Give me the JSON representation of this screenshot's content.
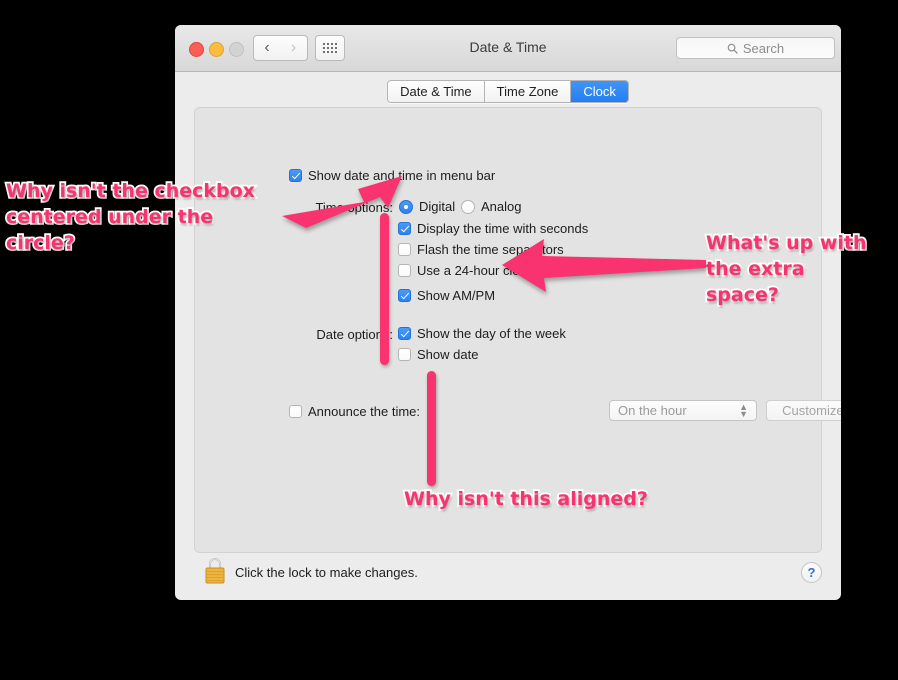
{
  "window": {
    "title": "Date & Time",
    "traffic_lights": [
      "close",
      "minimize",
      "zoom"
    ],
    "nav": {
      "back_icon": "chevron-left-icon",
      "forward_icon": "chevron-right-icon",
      "grid_icon": "grid-dots-icon"
    },
    "search": {
      "placeholder": "Search",
      "icon": "search-icon"
    }
  },
  "tabs": [
    {
      "label": "Date & Time",
      "active": false
    },
    {
      "label": "Time Zone",
      "active": false
    },
    {
      "label": "Clock",
      "active": true
    }
  ],
  "panel": {
    "show_menubar": {
      "label": "Show date and time in menu bar",
      "checked": true
    },
    "time_options": {
      "field_label": "Time options:",
      "radios": [
        {
          "label": "Digital",
          "selected": true
        },
        {
          "label": "Analog",
          "selected": false
        }
      ],
      "checkboxes": [
        {
          "label": "Display the time with seconds",
          "checked": true
        },
        {
          "label": "Flash the time separators",
          "checked": false
        },
        {
          "label": "Use a 24-hour clock",
          "checked": false
        },
        {
          "label": "Show AM/PM",
          "checked": true
        }
      ]
    },
    "date_options": {
      "field_label": "Date options:",
      "checkboxes": [
        {
          "label": "Show the day of the week",
          "checked": true
        },
        {
          "label": "Show date",
          "checked": false
        }
      ]
    },
    "announce": {
      "checkbox_label": "Announce the time:",
      "checked": false,
      "popup_value": "On the hour",
      "button_label": "Customize Voice...",
      "disabled": true
    }
  },
  "bottom_bar": {
    "lock_icon": "padlock-closed-icon",
    "lock_text": "Click the lock to make changes.",
    "help_label": "?"
  },
  "annotations": {
    "accent_color": "#f8336f",
    "outline_color": "#ffffff",
    "left_note": "Why isn't the checkbox\ncentered under the\ncircle?",
    "right_note": "What's up with\nthe extra\nspace?",
    "bottom_note": "Why isn't this aligned?",
    "markers": [
      {
        "name": "arrow-to-radio",
        "kind": "arrow",
        "direction": "right"
      },
      {
        "name": "arrow-to-show-ampm",
        "kind": "arrow",
        "direction": "left"
      },
      {
        "name": "bar-checkbox-column",
        "kind": "vertical-bar"
      },
      {
        "name": "bar-announce-alignment",
        "kind": "vertical-bar"
      }
    ]
  }
}
